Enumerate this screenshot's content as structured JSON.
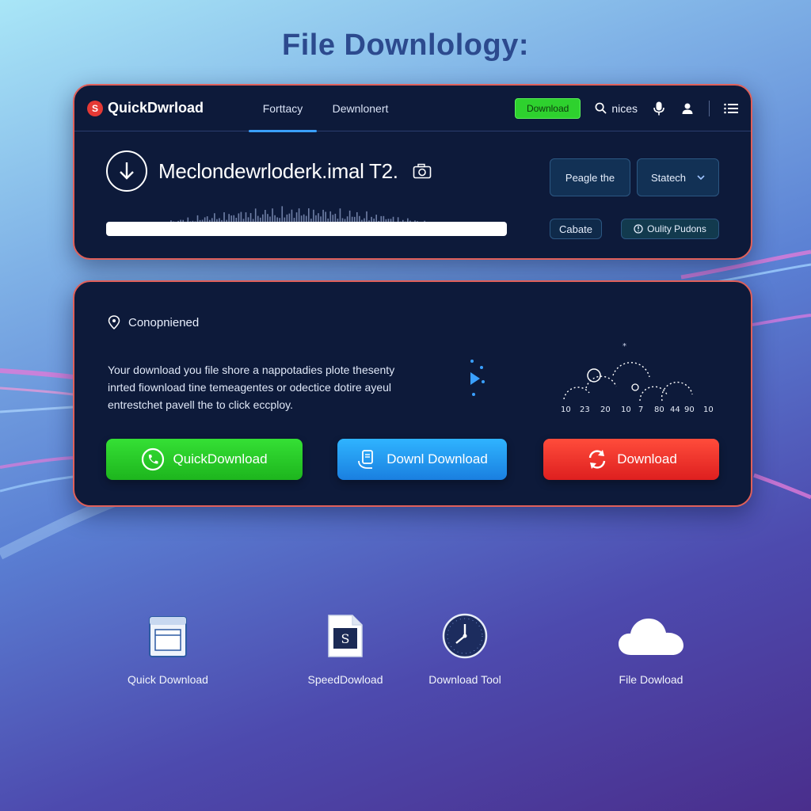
{
  "page": {
    "title": "File Downlology:"
  },
  "navbar": {
    "brand": "QuickDwrload",
    "brand_logo_letter": "S",
    "tabs": [
      {
        "label": "Forttacy",
        "active": true
      },
      {
        "label": "Dewnlonert",
        "active": false
      }
    ],
    "download_button": "Download",
    "search_label": "nices",
    "icons": [
      "search-icon",
      "microphone-icon",
      "user-icon",
      "menu-icon"
    ]
  },
  "file": {
    "name": "Meclondewrloderk.imal T2.",
    "progress": 1.0,
    "buttons": {
      "primary_left": "Peagle the",
      "primary_right": "Statech",
      "secondary_left": "Cabate",
      "secondary_right": "Oulity Pudons"
    }
  },
  "status": {
    "label": "Conopniened",
    "description": [
      "Your download you file shore a nappotadies plote thesenty",
      "inrted fiownload tine temeagentes or odectice dotire ayeul",
      "entrestchet pavell the to click eccploy."
    ]
  },
  "gauge": {
    "labels": [
      "10",
      "23",
      "20",
      "10",
      "7",
      "80",
      "44",
      "90",
      "10"
    ]
  },
  "actions": [
    {
      "label": "QuickDownload",
      "color": "#22c922"
    },
    {
      "label": "Downl Download",
      "color": "#1f95f0"
    },
    {
      "label": "Download",
      "color": "#ee2c26"
    }
  ],
  "tools": [
    {
      "label": "Quick Download",
      "icon": "window-icon"
    },
    {
      "label": "SpeedDowload",
      "icon": "document-s-icon"
    },
    {
      "label": "Download Tool",
      "icon": "clock-icon"
    },
    {
      "label": "File Dowload",
      "icon": "cloud-icon"
    }
  ],
  "colors": {
    "accent": "#3aa0ff",
    "panel": "#0d1a3a",
    "border": "#e0605a"
  }
}
